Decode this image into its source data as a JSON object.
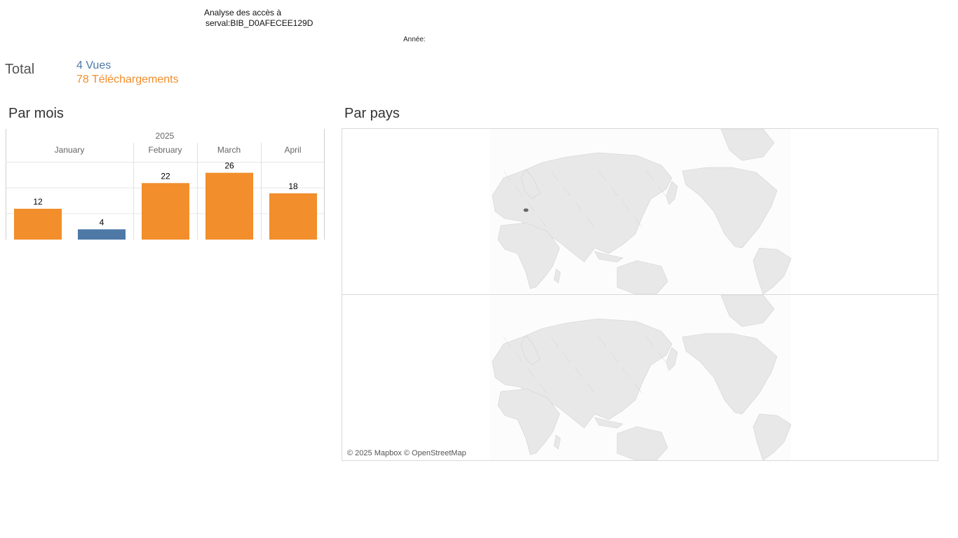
{
  "header": {
    "title_line1": "Analyse des accès à",
    "title_line2": "serval:BIB_D0AFECEE129D",
    "year_filter_label": "Année:"
  },
  "totals": {
    "label": "Total",
    "views": "4 Vues",
    "downloads": "78 Téléchargements"
  },
  "sections": {
    "by_month": "Par mois",
    "by_country": "Par pays"
  },
  "colors": {
    "views": "#4e79a7",
    "downloads": "#f28e2b",
    "grid": "#e6e6e6",
    "land": "#e8e8e8",
    "highlight_country": "#666666"
  },
  "chart_data": {
    "type": "bar",
    "year": "2025",
    "categories": [
      "January",
      "February",
      "March",
      "April"
    ],
    "series": [
      {
        "name": "Téléchargements",
        "color": "#f28e2b",
        "values": [
          12,
          22,
          26,
          18
        ]
      },
      {
        "name": "Vues",
        "color": "#4e79a7",
        "values": [
          4,
          null,
          null,
          null
        ]
      }
    ],
    "ylim": [
      0,
      30
    ],
    "grid": true
  },
  "map": {
    "attribution": "© 2025 Mapbox © OpenStreetMap",
    "highlighted_country": "Switzerland"
  }
}
